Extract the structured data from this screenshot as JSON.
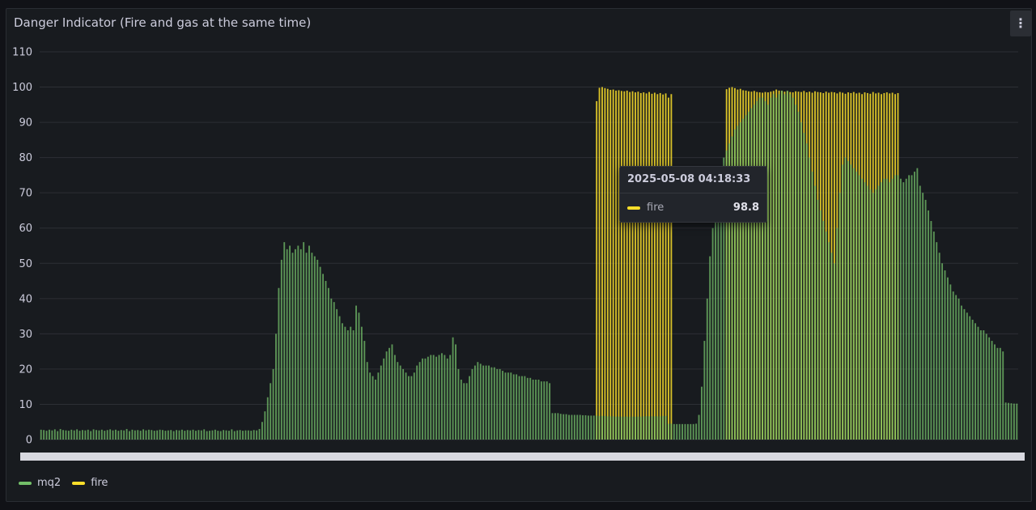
{
  "panel": {
    "title": "Danger Indicator (Fire and gas at the same time)",
    "menu_icon": "vertical-dots-icon"
  },
  "colors": {
    "mq2": "#73bf69",
    "fire": "#fade2a",
    "grid": "#2c2f35",
    "background": "#181b1f"
  },
  "tooltip": {
    "time": "2025-05-08 04:18:33",
    "series": "fire",
    "value": "98.8"
  },
  "legend": [
    {
      "name": "mq2",
      "color": "#73bf69"
    },
    {
      "name": "fire",
      "color": "#fade2a"
    }
  ],
  "chart_data": {
    "type": "bar",
    "ylim": [
      0,
      110
    ],
    "yticks": [
      0,
      10,
      20,
      30,
      40,
      50,
      60,
      70,
      80,
      90,
      100,
      110
    ],
    "grid": true,
    "legend_position": "bottom-left",
    "xlabel": "",
    "ylabel": "",
    "series": [
      {
        "name": "mq2",
        "color": "#73bf69",
        "values": [
          2.8,
          2.7,
          2.5,
          2.8,
          2.6,
          2.9,
          2.4,
          3.0,
          2.7,
          2.6,
          2.5,
          2.8,
          2.6,
          2.9,
          2.5,
          2.7,
          2.6,
          2.8,
          2.4,
          2.9,
          2.7,
          2.6,
          2.8,
          2.5,
          2.7,
          2.9,
          2.6,
          2.8,
          2.5,
          2.7,
          2.6,
          3.0,
          2.4,
          2.8,
          2.6,
          2.7,
          2.5,
          2.9,
          2.6,
          2.8,
          2.7,
          2.5,
          2.6,
          2.8,
          2.7,
          2.5,
          2.6,
          2.7,
          2.4,
          2.7,
          2.6,
          2.8,
          2.5,
          2.7,
          2.6,
          2.8,
          2.5,
          2.7,
          2.6,
          2.9,
          2.4,
          2.5,
          2.6,
          2.8,
          2.5,
          2.4,
          2.7,
          2.6,
          2.5,
          2.9,
          2.4,
          2.6,
          2.7,
          2.5,
          2.6,
          2.6,
          2.5,
          2.7,
          2.6,
          3.0,
          5.0,
          8.0,
          12.0,
          16.0,
          20.0,
          30.0,
          43.0,
          51.0,
          56.0,
          54.0,
          55.0,
          53.0,
          54.0,
          55.0,
          54.0,
          56.0,
          53.0,
          55.0,
          53.0,
          52.0,
          51.0,
          49.0,
          47.0,
          45.0,
          43.0,
          40.0,
          39.0,
          37.0,
          35.0,
          33.0,
          32.0,
          31.0,
          32.0,
          31.0,
          38.0,
          36.0,
          32.0,
          28.0,
          22.0,
          19.0,
          18.0,
          17.0,
          19.0,
          21.0,
          23.0,
          25.0,
          26.0,
          27.0,
          24.0,
          22.0,
          21.0,
          20.0,
          19.0,
          18.0,
          18.0,
          19.0,
          21.0,
          22.0,
          23.0,
          23.0,
          23.5,
          24.0,
          24.0,
          23.5,
          24.0,
          24.5,
          24.0,
          23.0,
          24.0,
          29.0,
          27.0,
          20.0,
          17.0,
          16.0,
          16.0,
          18.0,
          20.0,
          21.0,
          22.0,
          21.5,
          21.0,
          21.0,
          21.0,
          20.5,
          20.5,
          20.0,
          20.0,
          19.5,
          19.0,
          19.0,
          19.0,
          18.5,
          18.5,
          18.0,
          18.0,
          18.0,
          17.5,
          17.5,
          17.0,
          17.0,
          17.0,
          16.5,
          16.5,
          16.5,
          16.0,
          7.5,
          7.5,
          7.5,
          7.3,
          7.2,
          7.2,
          7.0,
          7.0,
          7.0,
          7.0,
          7.0,
          6.9,
          6.9,
          6.8,
          6.8,
          6.8,
          6.8,
          6.7,
          6.7,
          6.7,
          6.6,
          6.6,
          6.6,
          6.5,
          6.5,
          6.5,
          6.5,
          6.5,
          6.5,
          6.5,
          6.5,
          6.5,
          6.5,
          6.6,
          6.6,
          6.6,
          6.6,
          6.6,
          6.6,
          6.6,
          6.7,
          6.7,
          4.5,
          4.5,
          4.4,
          4.4,
          4.4,
          4.4,
          4.4,
          4.4,
          4.4,
          4.4,
          4.5,
          7.0,
          15.0,
          28.0,
          40.0,
          52.0,
          60.0,
          66.0,
          71.0,
          75.0,
          80.0,
          82.0,
          84.0,
          86.0,
          88.0,
          89.0,
          90.0,
          91.0,
          92.0,
          93.0,
          94.0,
          95.0,
          96.0,
          97.0,
          97.0,
          96.0,
          95.0,
          97.0,
          98.0,
          97.0,
          98.0,
          99.0,
          98.0,
          99.0,
          98.0,
          97.0,
          95.0,
          93.0,
          90.0,
          87.0,
          84.0,
          80.0,
          76.0,
          72.0,
          68.0,
          65.0,
          62.0,
          59.0,
          56.0,
          53.0,
          50.0,
          60.0,
          70.0,
          78.0,
          80.0,
          79.0,
          78.0,
          77.0,
          76.0,
          75.0,
          74.0,
          73.0,
          72.0,
          71.0,
          70.0,
          71.0,
          72.0,
          73.0,
          74.0,
          74.0,
          73.0,
          74.0,
          75.0,
          75.0,
          74.0,
          73.0,
          74.0,
          75.0,
          75.0,
          76.0,
          77.0,
          72.0,
          70.0,
          68.0,
          65.0,
          62.0,
          59.0,
          56.0,
          53.0,
          50.0,
          48.0,
          46.0,
          44.0,
          42.0,
          41.0,
          40.0,
          38.0,
          37.0,
          36.0,
          35.0,
          34.0,
          33.0,
          32.0,
          31.0,
          31.0,
          30.0,
          29.0,
          28.0,
          27.0,
          26.0,
          26.0,
          25.0,
          10.5,
          10.4,
          10.3,
          10.2,
          10.2
        ]
      },
      {
        "name": "fire",
        "color": "#fade2a",
        "points": [
          {
            "i": 201,
            "v": 96.0
          },
          {
            "i": 202,
            "v": 99.8
          },
          {
            "i": 203,
            "v": 100.0
          },
          {
            "i": 204,
            "v": 99.7
          },
          {
            "i": 205,
            "v": 99.5
          },
          {
            "i": 206,
            "v": 99.2
          },
          {
            "i": 207,
            "v": 99.3
          },
          {
            "i": 208,
            "v": 99.0
          },
          {
            "i": 209,
            "v": 99.1
          },
          {
            "i": 210,
            "v": 98.9
          },
          {
            "i": 211,
            "v": 98.8
          },
          {
            "i": 212,
            "v": 99.0
          },
          {
            "i": 213,
            "v": 98.6
          },
          {
            "i": 214,
            "v": 98.8
          },
          {
            "i": 215,
            "v": 98.5
          },
          {
            "i": 216,
            "v": 98.7
          },
          {
            "i": 217,
            "v": 98.3
          },
          {
            "i": 218,
            "v": 98.5
          },
          {
            "i": 219,
            "v": 98.2
          },
          {
            "i": 220,
            "v": 98.6
          },
          {
            "i": 221,
            "v": 98.1
          },
          {
            "i": 222,
            "v": 98.4
          },
          {
            "i": 223,
            "v": 98.0
          },
          {
            "i": 224,
            "v": 98.3
          },
          {
            "i": 225,
            "v": 97.9
          },
          {
            "i": 226,
            "v": 98.2
          },
          {
            "i": 227,
            "v": 97.0
          },
          {
            "i": 228,
            "v": 98.0
          },
          {
            "i": 248,
            "v": 99.4
          },
          {
            "i": 249,
            "v": 99.8
          },
          {
            "i": 250,
            "v": 100.0
          },
          {
            "i": 251,
            "v": 99.7
          },
          {
            "i": 252,
            "v": 99.3
          },
          {
            "i": 253,
            "v": 99.5
          },
          {
            "i": 254,
            "v": 99.1
          },
          {
            "i": 255,
            "v": 99.0
          },
          {
            "i": 256,
            "v": 98.8
          },
          {
            "i": 257,
            "v": 98.7
          },
          {
            "i": 258,
            "v": 98.9
          },
          {
            "i": 259,
            "v": 98.6
          },
          {
            "i": 260,
            "v": 98.5
          },
          {
            "i": 261,
            "v": 98.4
          },
          {
            "i": 262,
            "v": 98.6
          },
          {
            "i": 263,
            "v": 98.5
          },
          {
            "i": 264,
            "v": 98.7
          },
          {
            "i": 265,
            "v": 98.9
          },
          {
            "i": 266,
            "v": 99.3
          },
          {
            "i": 267,
            "v": 99.0
          },
          {
            "i": 268,
            "v": 98.9
          },
          {
            "i": 269,
            "v": 98.7
          },
          {
            "i": 270,
            "v": 98.8
          },
          {
            "i": 271,
            "v": 98.6
          },
          {
            "i": 272,
            "v": 98.5
          },
          {
            "i": 273,
            "v": 98.8
          },
          {
            "i": 274,
            "v": 98.7
          },
          {
            "i": 275,
            "v": 98.6
          },
          {
            "i": 276,
            "v": 98.9
          },
          {
            "i": 277,
            "v": 98.5
          },
          {
            "i": 278,
            "v": 98.7
          },
          {
            "i": 279,
            "v": 98.4
          },
          {
            "i": 280,
            "v": 98.8
          },
          {
            "i": 281,
            "v": 98.6
          },
          {
            "i": 282,
            "v": 98.5
          },
          {
            "i": 283,
            "v": 98.3
          },
          {
            "i": 284,
            "v": 98.7
          },
          {
            "i": 285,
            "v": 98.4
          },
          {
            "i": 286,
            "v": 98.6
          },
          {
            "i": 287,
            "v": 98.5
          },
          {
            "i": 288,
            "v": 98.2
          },
          {
            "i": 289,
            "v": 98.6
          },
          {
            "i": 290,
            "v": 98.4
          },
          {
            "i": 291,
            "v": 98.1
          },
          {
            "i": 292,
            "v": 98.5
          },
          {
            "i": 293,
            "v": 98.3
          },
          {
            "i": 294,
            "v": 98.6
          },
          {
            "i": 295,
            "v": 98.2
          },
          {
            "i": 296,
            "v": 98.4
          },
          {
            "i": 297,
            "v": 98.0
          },
          {
            "i": 298,
            "v": 98.5
          },
          {
            "i": 299,
            "v": 98.3
          },
          {
            "i": 300,
            "v": 98.1
          },
          {
            "i": 301,
            "v": 98.6
          },
          {
            "i": 302,
            "v": 98.2
          },
          {
            "i": 303,
            "v": 98.4
          },
          {
            "i": 304,
            "v": 98.0
          },
          {
            "i": 305,
            "v": 98.3
          },
          {
            "i": 306,
            "v": 98.5
          },
          {
            "i": 307,
            "v": 98.2
          },
          {
            "i": 308,
            "v": 98.4
          },
          {
            "i": 309,
            "v": 98.0
          },
          {
            "i": 310,
            "v": 98.3
          }
        ]
      }
    ]
  }
}
